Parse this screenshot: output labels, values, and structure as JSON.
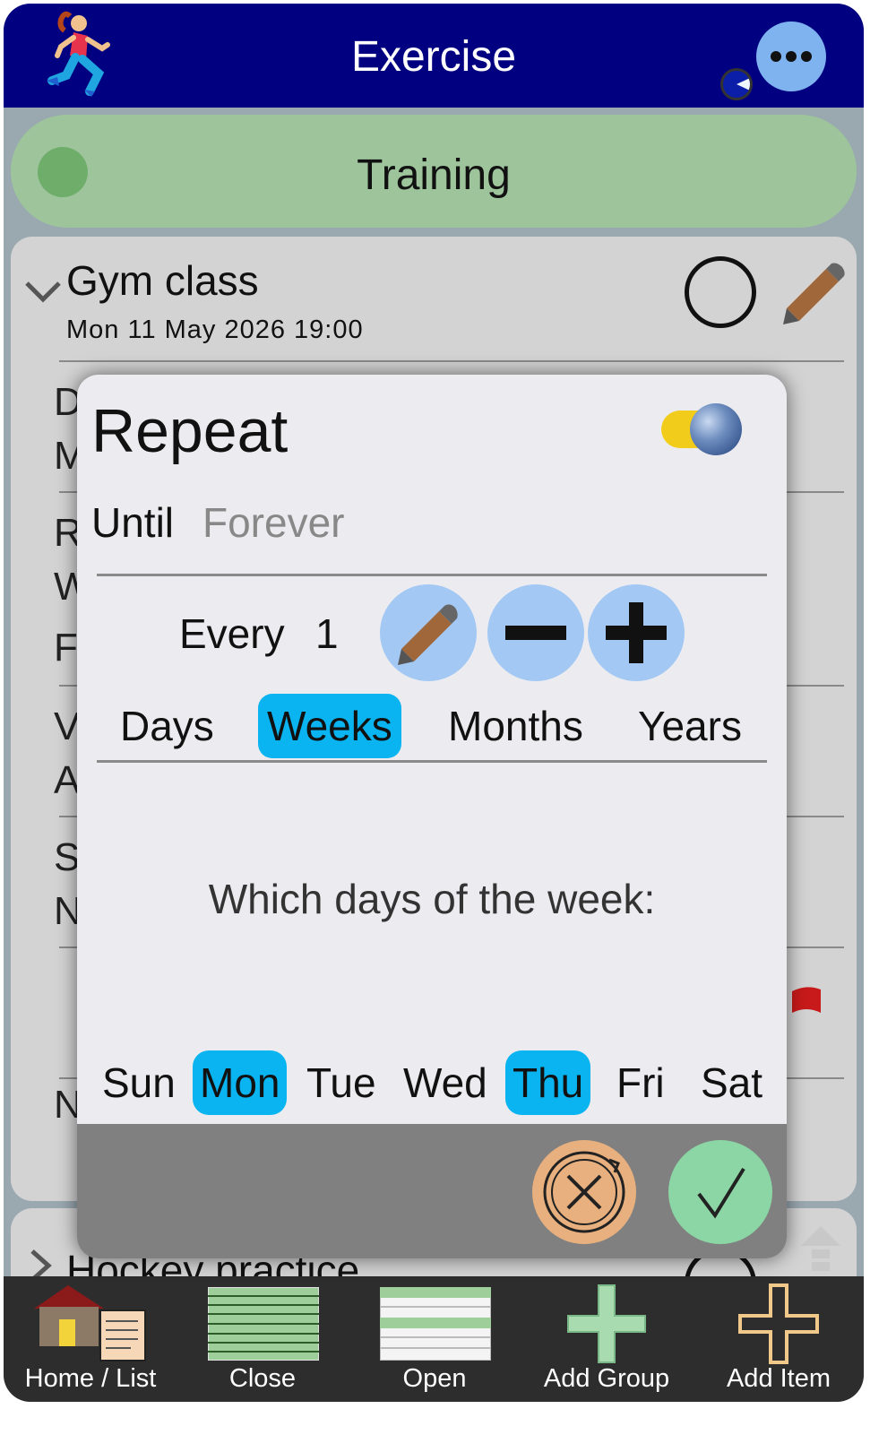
{
  "header": {
    "title": "Exercise",
    "icons": [
      "runner-icon",
      "more-icon",
      "progress-icon"
    ]
  },
  "group": {
    "title": "Training",
    "color": "#9ec49b"
  },
  "card": {
    "title": "Gym class",
    "date": "Mon 11 May 2026 19:00",
    "row_letters": [
      "D",
      "M",
      "R",
      "W",
      "F",
      "V",
      "A",
      "S",
      "N",
      "N"
    ]
  },
  "card2": {
    "title": "Hockey practice"
  },
  "modal": {
    "title": "Repeat",
    "toggle_on": true,
    "until_label": "Until",
    "until_value": "Forever",
    "every_label": "Every",
    "every_value": "1",
    "units": [
      {
        "label": "Days",
        "selected": false
      },
      {
        "label": "Weeks",
        "selected": true
      },
      {
        "label": "Months",
        "selected": false
      },
      {
        "label": "Years",
        "selected": false
      }
    ],
    "days_question": "Which days of the week:",
    "days": [
      {
        "label": "Sun",
        "selected": false
      },
      {
        "label": "Mon",
        "selected": true
      },
      {
        "label": "Tue",
        "selected": false
      },
      {
        "label": "Wed",
        "selected": false
      },
      {
        "label": "Thu",
        "selected": true
      },
      {
        "label": "Fri",
        "selected": false
      },
      {
        "label": "Sat",
        "selected": false
      }
    ],
    "accent": "#0ab4f0"
  },
  "toolbar": {
    "home_list": "Home / List",
    "close": "Close",
    "open": "Open",
    "add_group": "Add Group",
    "add_item": "Add Item"
  }
}
